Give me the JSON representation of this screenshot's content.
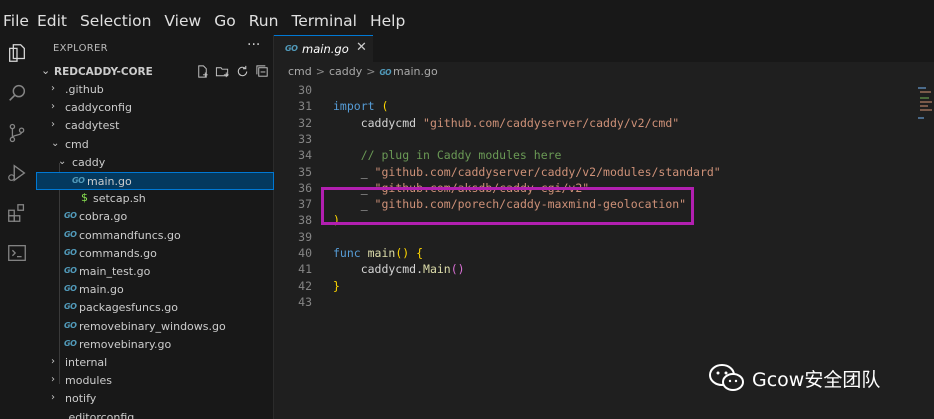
{
  "menu": [
    "File",
    "Edit",
    "Selection",
    "View",
    "Go",
    "Run",
    "Terminal",
    "Help"
  ],
  "activity_icons": [
    "explorer-icon",
    "search-icon",
    "source-control-icon",
    "run-debug-icon",
    "extensions-icon",
    "terminal-icon"
  ],
  "sidebar": {
    "title": "EXPLORER",
    "more": "···",
    "root_folder": "REDCADDY-CORE",
    "tree": [
      {
        "label": ".github",
        "kind": "folder",
        "depth": 1
      },
      {
        "label": "caddyconfig",
        "kind": "folder",
        "depth": 1
      },
      {
        "label": "caddytest",
        "kind": "folder",
        "depth": 1
      },
      {
        "label": "cmd",
        "kind": "folder-open",
        "depth": 1
      },
      {
        "label": "caddy",
        "kind": "folder-open",
        "depth": 2
      },
      {
        "label": "main.go",
        "kind": "go",
        "depth": 3,
        "selected": true
      },
      {
        "label": "setcap.sh",
        "kind": "sh",
        "depth": 3
      },
      {
        "label": "cobra.go",
        "kind": "go",
        "depth": 2
      },
      {
        "label": "commandfuncs.go",
        "kind": "go",
        "depth": 2
      },
      {
        "label": "commands.go",
        "kind": "go",
        "depth": 2
      },
      {
        "label": "main_test.go",
        "kind": "go",
        "depth": 2
      },
      {
        "label": "main.go",
        "kind": "go",
        "depth": 2
      },
      {
        "label": "packagesfuncs.go",
        "kind": "go",
        "depth": 2
      },
      {
        "label": "removebinary_windows.go",
        "kind": "go",
        "depth": 2
      },
      {
        "label": "removebinary.go",
        "kind": "go",
        "depth": 2
      },
      {
        "label": "internal",
        "kind": "folder",
        "depth": 1
      },
      {
        "label": "modules",
        "kind": "folder",
        "depth": 1
      },
      {
        "label": "notify",
        "kind": "folder",
        "depth": 1
      },
      {
        "label": ".editorconfig",
        "kind": "file",
        "depth": 1
      }
    ]
  },
  "editor": {
    "tab_label": "main.go",
    "tab_close": "✕",
    "go_badge": "GO",
    "breadcrumb": [
      "cmd",
      "caddy",
      "main.go"
    ],
    "breadcrumb_sep": ">",
    "lines": [
      {
        "n": "30",
        "segs": []
      },
      {
        "n": "31",
        "segs": [
          {
            "t": "import ",
            "c": "kw"
          },
          {
            "t": "(",
            "c": "paren1"
          }
        ]
      },
      {
        "n": "32",
        "segs": [
          {
            "t": "    caddycmd ",
            "c": "pn"
          },
          {
            "t": "\"github.com/caddyserver/caddy/v2/cmd\"",
            "c": "str"
          }
        ]
      },
      {
        "n": "33",
        "segs": []
      },
      {
        "n": "34",
        "segs": [
          {
            "t": "    // plug in Caddy modules here",
            "c": "cm"
          }
        ]
      },
      {
        "n": "35",
        "segs": [
          {
            "t": "    _ ",
            "c": "pn"
          },
          {
            "t": "\"github.com/caddyserver/caddy/v2/modules/standard\"",
            "c": "str"
          }
        ]
      },
      {
        "n": "36",
        "segs": [
          {
            "t": "    _ ",
            "c": "pn"
          },
          {
            "t": "\"github.com/aksdb/caddy-cgi/v2\"",
            "c": "str"
          }
        ]
      },
      {
        "n": "37",
        "segs": [
          {
            "t": "    _ ",
            "c": "pn"
          },
          {
            "t": "\"github.com/porech/caddy-maxmind-geolocation\"",
            "c": "str"
          }
        ]
      },
      {
        "n": "38",
        "segs": [
          {
            "t": ")",
            "c": "paren1"
          }
        ]
      },
      {
        "n": "39",
        "segs": []
      },
      {
        "n": "40",
        "segs": [
          {
            "t": "func ",
            "c": "kw"
          },
          {
            "t": "main",
            "c": "fn"
          },
          {
            "t": "()",
            "c": "paren1"
          },
          {
            "t": " ",
            "c": "pn"
          },
          {
            "t": "{",
            "c": "paren1"
          }
        ]
      },
      {
        "n": "41",
        "segs": [
          {
            "t": "    caddycmd.",
            "c": "pn"
          },
          {
            "t": "Main",
            "c": "fn"
          },
          {
            "t": "()",
            "c": "paren2"
          }
        ]
      },
      {
        "n": "42",
        "segs": [
          {
            "t": "}",
            "c": "paren1"
          }
        ]
      },
      {
        "n": "43",
        "segs": []
      }
    ]
  },
  "watermark": {
    "text": "Gcow安全团队",
    "logo": "wechat-logo"
  },
  "colors": {
    "selection": "#04395e",
    "focus_border": "#0078d4",
    "highlight_box": "#b21fb0",
    "go_icon": "#519aba"
  }
}
